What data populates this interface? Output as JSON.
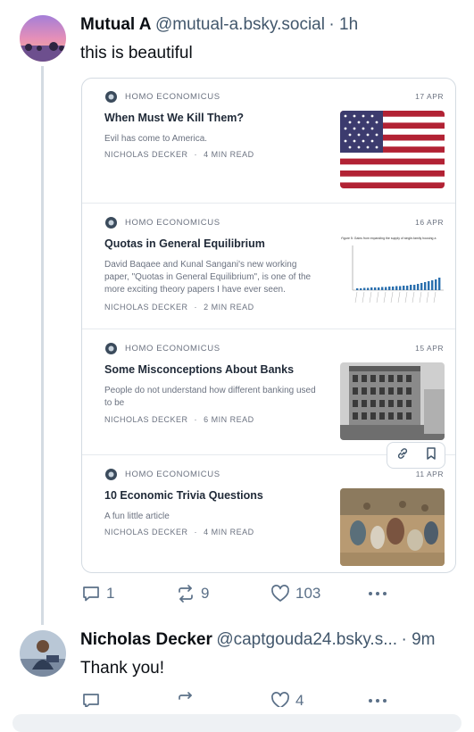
{
  "post1": {
    "name": "Mutual A",
    "handle": "@mutual-a.bsky.social",
    "time": "· 1h",
    "text": "this is beautiful",
    "actions": {
      "replies": "1",
      "reposts": "9",
      "likes": "103"
    }
  },
  "card": {
    "entries": [
      {
        "publication": "HOMO ECONOMICUS",
        "date": "17 APR",
        "title": "When Must We Kill Them?",
        "subtitle_lines": [
          "Evil has come to America."
        ],
        "author": "NICHOLAS DECKER",
        "read_time": "4 MIN READ",
        "thumb": "us-flag"
      },
      {
        "publication": "HOMO ECONOMICUS",
        "date": "16 APR",
        "title": "Quotas in General Equilibrium",
        "subtitle_lines": [
          "David Baqaee and Kunal Sangani's new working",
          "paper, \"Quotas in General Equilibrium\", is one of the",
          "more exciting theory papers I have ever seen."
        ],
        "author": "NICHOLAS DECKER",
        "read_time": "2 MIN READ",
        "thumb": "figure-bar-chart"
      },
      {
        "publication": "HOMO ECONOMICUS",
        "date": "15 APR",
        "title": "Some Misconceptions About Banks",
        "subtitle_lines": [
          "People do not understand how different banking used",
          "to be"
        ],
        "author": "NICHOLAS DECKER",
        "read_time": "6 MIN READ",
        "thumb": "bank-building-photo"
      },
      {
        "publication": "HOMO ECONOMICUS",
        "date": "11 APR",
        "title": "10 Economic Trivia Questions",
        "subtitle_lines": [
          "A fun little article"
        ],
        "author": "NICHOLAS DECKER",
        "read_time": "4 MIN READ",
        "thumb": "painting"
      }
    ],
    "thumb_caption": "Figure 5: Gains from expanding the supply of single-family housing a",
    "separator": "·"
  },
  "post2": {
    "name": "Nicholas Decker",
    "handle": "@captgouda24.bsky.s...",
    "time": "· 9m",
    "text": "Thank you!",
    "actions": {
      "likes": "4"
    }
  },
  "colors": {
    "accent": "#1083fe",
    "muted": "#42576c",
    "icon": "#5b7088",
    "border": "#d4dbe2"
  }
}
